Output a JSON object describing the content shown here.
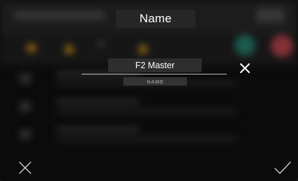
{
  "dialog": {
    "title": "Name",
    "field": {
      "value": "F2 Master",
      "label": "NAME"
    },
    "icons": {
      "clear": "close-icon",
      "cancel": "close-icon",
      "confirm": "checkmark-icon"
    }
  },
  "colors": {
    "overlay_background": "#141414",
    "text": "#ffffff",
    "label_text": "#8a8a8a",
    "underline": "#bdbdbd",
    "background_accent_yellow": "#c9921f",
    "background_accent_teal": "#2b8a77",
    "background_accent_red": "#c94a54"
  }
}
